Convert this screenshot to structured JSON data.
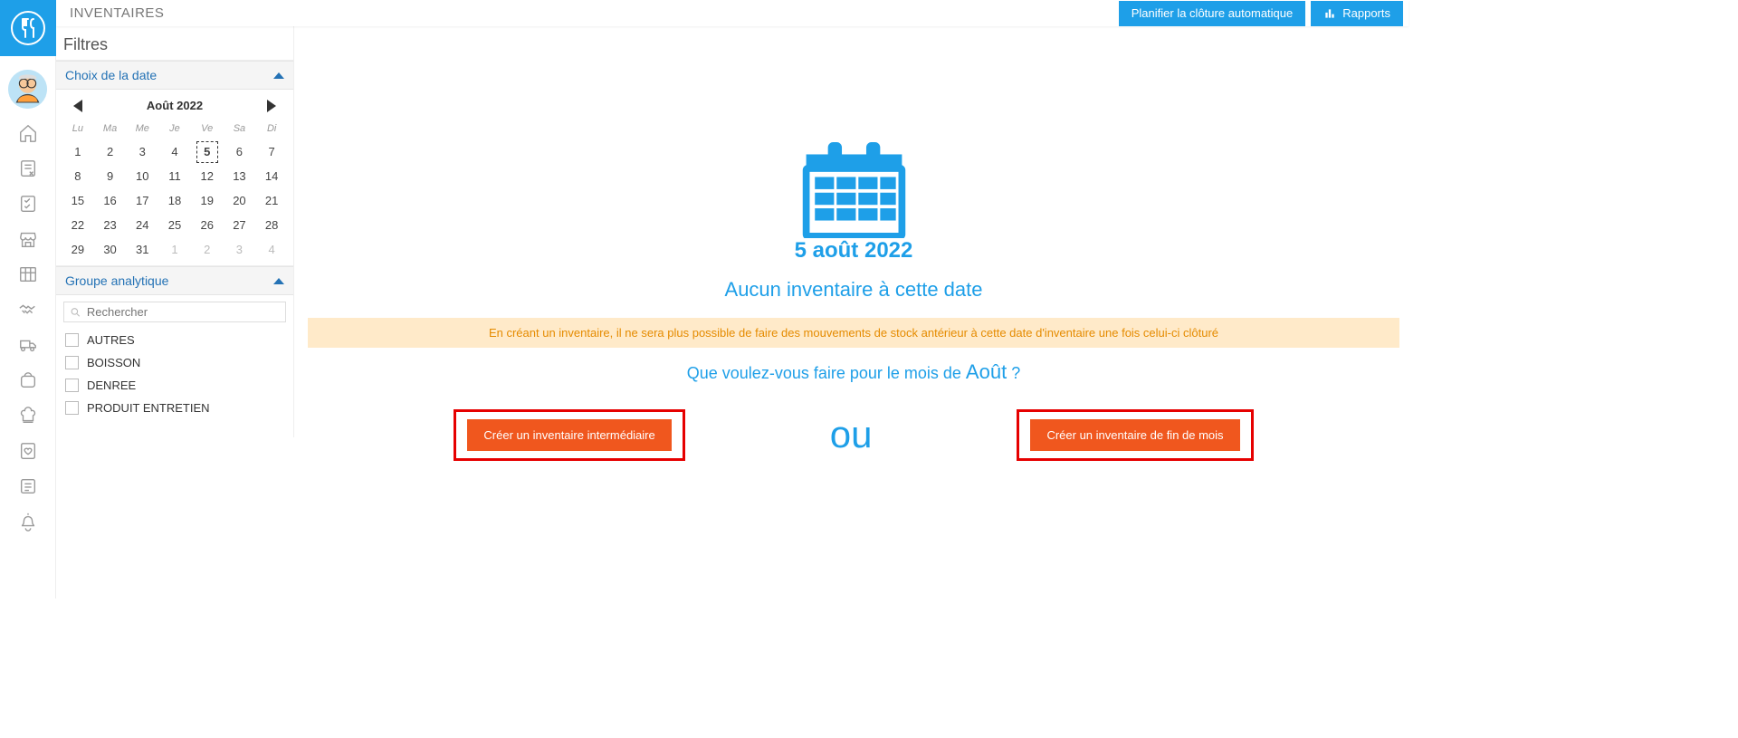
{
  "header": {
    "page_title": "INVENTAIRES",
    "plan_button": "Planifier la clôture automatique",
    "reports_button": "Rapports"
  },
  "filters": {
    "title": "Filtres",
    "date_panel": "Choix de la date",
    "group_panel": "Groupe analytique",
    "search_placeholder": "Rechercher",
    "groups": [
      "AUTRES",
      "BOISSON",
      "DENREE",
      "PRODUIT ENTRETIEN"
    ]
  },
  "calendar": {
    "month_label": "Août 2022",
    "dow": [
      "Lu",
      "Ma",
      "Me",
      "Je",
      "Ve",
      "Sa",
      "Di"
    ],
    "weeks": [
      [
        {
          "d": 1
        },
        {
          "d": 2
        },
        {
          "d": 3
        },
        {
          "d": 4
        },
        {
          "d": 5,
          "sel": true
        },
        {
          "d": 6
        },
        {
          "d": 7
        }
      ],
      [
        {
          "d": 8
        },
        {
          "d": 9
        },
        {
          "d": 10
        },
        {
          "d": 11
        },
        {
          "d": 12
        },
        {
          "d": 13
        },
        {
          "d": 14
        }
      ],
      [
        {
          "d": 15
        },
        {
          "d": 16
        },
        {
          "d": 17
        },
        {
          "d": 18
        },
        {
          "d": 19
        },
        {
          "d": 20
        },
        {
          "d": 21
        }
      ],
      [
        {
          "d": 22
        },
        {
          "d": 23
        },
        {
          "d": 24
        },
        {
          "d": 25
        },
        {
          "d": 26
        },
        {
          "d": 27
        },
        {
          "d": 28
        }
      ],
      [
        {
          "d": 29
        },
        {
          "d": 30
        },
        {
          "d": 31
        },
        {
          "d": 1,
          "trail": true
        },
        {
          "d": 2,
          "trail": true
        },
        {
          "d": 3,
          "trail": true
        },
        {
          "d": 4,
          "trail": true
        }
      ]
    ]
  },
  "main": {
    "selected_date": "5 août 2022",
    "no_inventory": "Aucun inventaire à cette date",
    "warning": "En créant un inventaire, il ne sera plus possible de faire des mouvements de stock antérieur à cette date d'inventaire une fois celui-ci clôturé",
    "question_prefix": "Que voulez-vous faire pour le mois de ",
    "question_month": "Août",
    "question_suffix": " ?",
    "or": "ou",
    "btn_intermediate": "Créer un inventaire intermédiaire",
    "btn_end_month": "Créer un inventaire de fin de mois"
  }
}
